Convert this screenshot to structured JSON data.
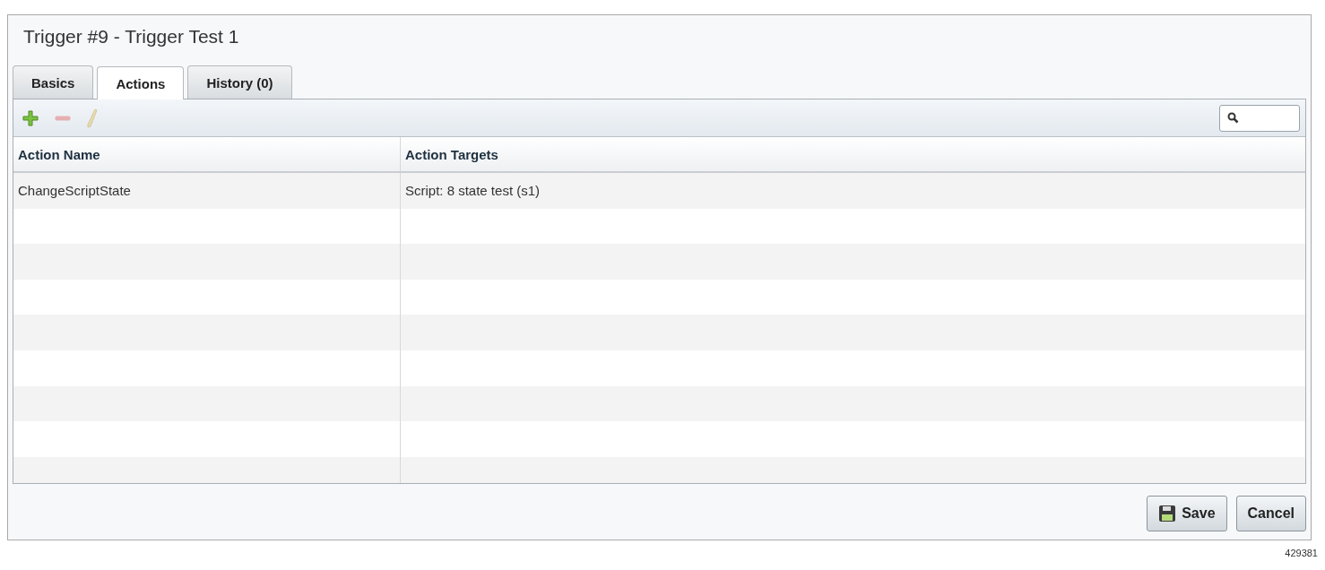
{
  "window": {
    "title": "Trigger #9 - Trigger Test 1"
  },
  "tabs": [
    {
      "label": "Basics",
      "selected": false
    },
    {
      "label": "Actions",
      "selected": true
    },
    {
      "label": "History (0)",
      "selected": false
    }
  ],
  "toolbar": {
    "tools": [
      {
        "kind": "add",
        "disabled": false
      },
      {
        "kind": "remove",
        "disabled": true
      },
      {
        "kind": "edit",
        "disabled": true
      }
    ]
  },
  "table": {
    "columns": [
      "Action Name",
      "Action Targets"
    ],
    "rows": [
      [
        "ChangeScriptState",
        "Script: 8 state test (s1)"
      ]
    ]
  },
  "buttons": [
    {
      "kind": "save",
      "label": "Save"
    },
    {
      "kind": "cancel",
      "label": "Cancel"
    }
  ],
  "figure_number": "429381"
}
